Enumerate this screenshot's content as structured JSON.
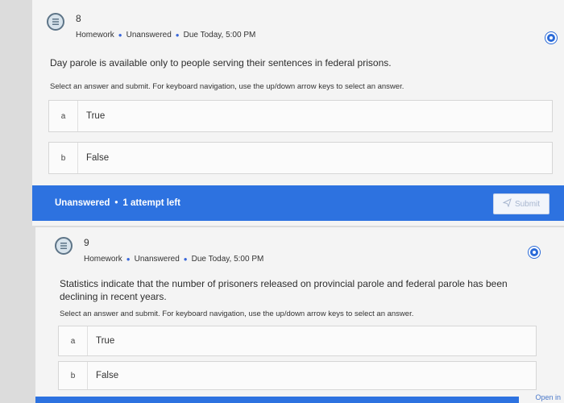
{
  "questions": [
    {
      "number": "8",
      "meta": {
        "type": "Homework",
        "status": "Unanswered",
        "due": "Due Today, 5:00 PM"
      },
      "text": "Day parole is available only to people serving their sentences in federal prisons.",
      "instructions": "Select an answer and submit. For keyboard navigation, use the up/down arrow keys to select an answer.",
      "options": [
        {
          "letter": "a",
          "text": "True"
        },
        {
          "letter": "b",
          "text": "False"
        }
      ],
      "status_bar": {
        "state": "Unanswered",
        "attempts": "1 attempt left",
        "submit_label": "Submit"
      }
    },
    {
      "number": "9",
      "meta": {
        "type": "Homework",
        "status": "Unanswered",
        "due": "Due Today, 5:00 PM"
      },
      "text": "Statistics indicate that the number of prisoners released on provincial parole and federal parole has been declining in recent years.",
      "instructions": "Select an answer and submit. For keyboard navigation, use the up/down arrow keys to select an answer.",
      "options": [
        {
          "letter": "a",
          "text": "True"
        },
        {
          "letter": "b",
          "text": "False"
        }
      ],
      "open_label": "Open in"
    }
  ],
  "icons": {
    "question_type": "list-icon",
    "submit": "send-icon",
    "selection": "radio-dot-icon"
  },
  "colors": {
    "accent": "#2d72e0",
    "radio": "#2a6ad8",
    "background": "#f4f4f4"
  }
}
